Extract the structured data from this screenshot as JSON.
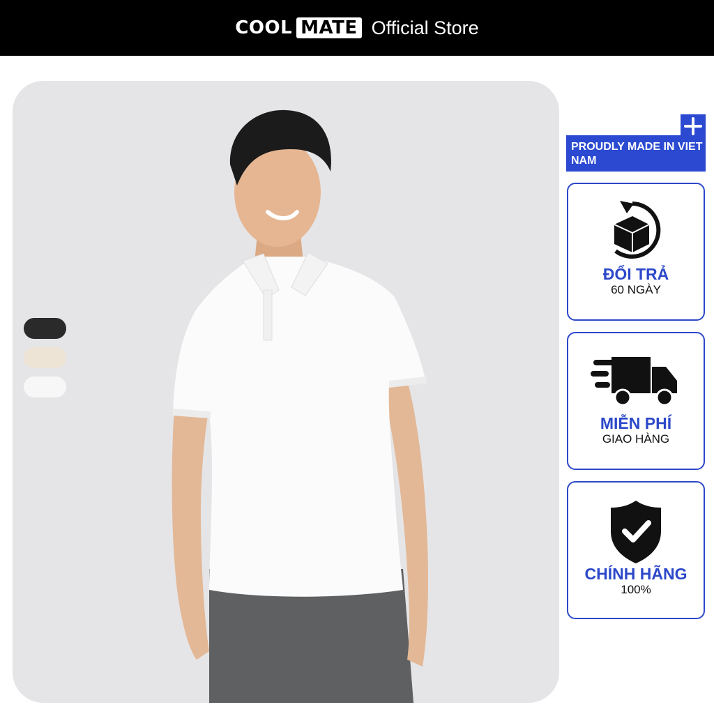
{
  "header": {
    "brand_part1": "COOL",
    "brand_part2": "MATE",
    "store_label": "Official Store"
  },
  "swatches": [
    {
      "name": "black",
      "color": "#2a2a2a"
    },
    {
      "name": "beige",
      "color": "#ede4d6"
    },
    {
      "name": "white",
      "color": "#f7f7f8"
    }
  ],
  "badges": {
    "made_in": "PROUDLY MADE IN VIET NAM",
    "return": {
      "title": "ĐỔI TRẢ",
      "sub": "60 NGÀY"
    },
    "shipping": {
      "title": "MIỄN PHÍ",
      "sub": "GIAO HÀNG"
    },
    "authentic": {
      "title": "CHÍNH HÃNG",
      "sub": "100%"
    }
  },
  "colors": {
    "accent": "#2c48c9",
    "header_bg": "#000000",
    "photo_bg": "#e5e5e7"
  }
}
